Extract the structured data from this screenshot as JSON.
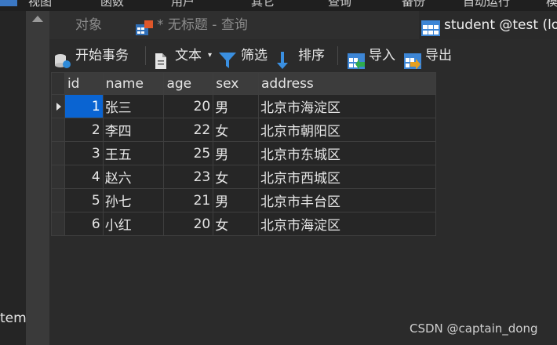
{
  "menubar": {
    "items": [
      "视图",
      "函数",
      "用户",
      "其它",
      "查询",
      "备份",
      "自动运行",
      "模"
    ]
  },
  "left_panel": {
    "item_text": "tem"
  },
  "tabs": {
    "objects": "对象",
    "query": "* 无标题 - 查询",
    "student": "student @test (lo"
  },
  "toolbar": {
    "begin_transaction": "开始事务",
    "text": "文本",
    "filter": "筛选",
    "sort": "排序",
    "import": "导入",
    "export": "导出"
  },
  "table": {
    "columns": [
      "id",
      "name",
      "age",
      "sex",
      "address"
    ],
    "rows": [
      [
        "1",
        "张三",
        "20",
        "男",
        "北京市海淀区"
      ],
      [
        "2",
        "李四",
        "22",
        "女",
        "北京市朝阳区"
      ],
      [
        "3",
        "王五",
        "25",
        "男",
        "北京市东城区"
      ],
      [
        "4",
        "赵六",
        "23",
        "女",
        "北京市西城区"
      ],
      [
        "5",
        "孙七",
        "21",
        "男",
        "北京市丰台区"
      ],
      [
        "6",
        "小红",
        "20",
        "女",
        "北京市海淀区"
      ]
    ],
    "selected_row": 0,
    "active_cell_color": "#0a64d2"
  },
  "watermark": "CSDN @captain_dong"
}
